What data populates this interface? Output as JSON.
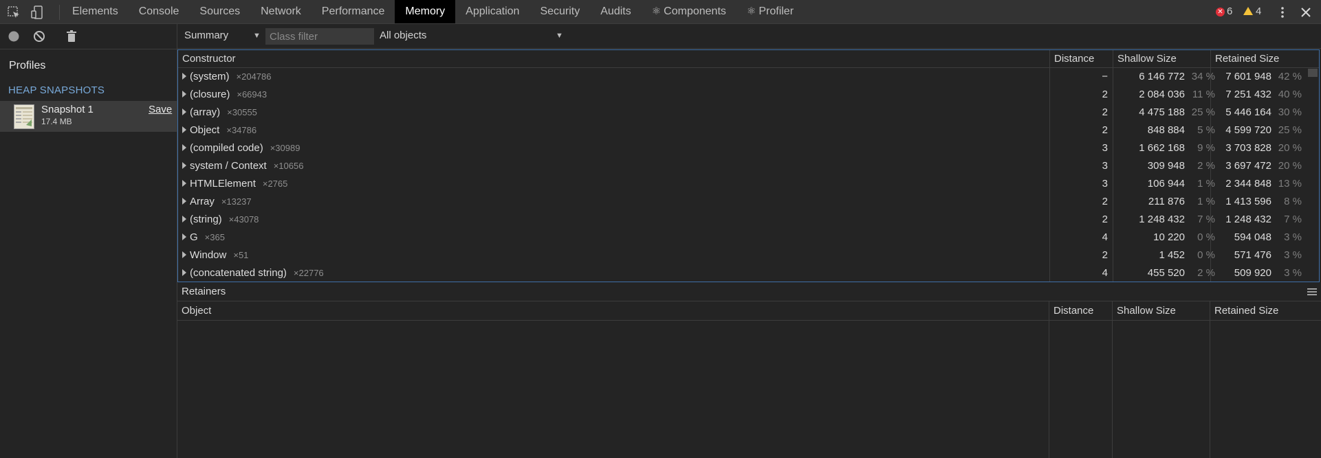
{
  "tabs": [
    {
      "label": "Elements"
    },
    {
      "label": "Console"
    },
    {
      "label": "Sources"
    },
    {
      "label": "Network"
    },
    {
      "label": "Performance"
    },
    {
      "label": "Memory",
      "active": true
    },
    {
      "label": "Application"
    },
    {
      "label": "Security"
    },
    {
      "label": "Audits"
    },
    {
      "label": "Components",
      "icon": "react-icon"
    },
    {
      "label": "Profiler",
      "icon": "react-icon"
    }
  ],
  "issues": {
    "errors": "6",
    "warnings": "4"
  },
  "sidebar": {
    "title": "Profiles",
    "section": "HEAP SNAPSHOTS",
    "snapshot": {
      "name": "Snapshot 1",
      "size": "17.4 MB",
      "save_label": "Save"
    }
  },
  "toolbar": {
    "view": "Summary",
    "class_filter_placeholder": "Class filter",
    "objects": "All objects"
  },
  "grid": {
    "columns": [
      "Constructor",
      "Distance",
      "Shallow Size",
      "Retained Size"
    ],
    "rows": [
      {
        "name": "(system)",
        "count": "×204786",
        "distance": "−",
        "shallow": "6 146 772",
        "shallow_pct": "34 %",
        "retained": "7 601 948",
        "retained_pct": "42 %"
      },
      {
        "name": "(closure)",
        "count": "×66943",
        "distance": "2",
        "shallow": "2 084 036",
        "shallow_pct": "11 %",
        "retained": "7 251 432",
        "retained_pct": "40 %"
      },
      {
        "name": "(array)",
        "count": "×30555",
        "distance": "2",
        "shallow": "4 475 188",
        "shallow_pct": "25 %",
        "retained": "5 446 164",
        "retained_pct": "30 %"
      },
      {
        "name": "Object",
        "count": "×34786",
        "distance": "2",
        "shallow": "848 884",
        "shallow_pct": "5 %",
        "retained": "4 599 720",
        "retained_pct": "25 %"
      },
      {
        "name": "(compiled code)",
        "count": "×30989",
        "distance": "3",
        "shallow": "1 662 168",
        "shallow_pct": "9 %",
        "retained": "3 703 828",
        "retained_pct": "20 %"
      },
      {
        "name": "system / Context",
        "count": "×10656",
        "distance": "3",
        "shallow": "309 948",
        "shallow_pct": "2 %",
        "retained": "3 697 472",
        "retained_pct": "20 %"
      },
      {
        "name": "HTMLElement",
        "count": "×2765",
        "distance": "3",
        "shallow": "106 944",
        "shallow_pct": "1 %",
        "retained": "2 344 848",
        "retained_pct": "13 %"
      },
      {
        "name": "Array",
        "count": "×13237",
        "distance": "2",
        "shallow": "211 876",
        "shallow_pct": "1 %",
        "retained": "1 413 596",
        "retained_pct": "8 %"
      },
      {
        "name": "(string)",
        "count": "×43078",
        "distance": "2",
        "shallow": "1 248 432",
        "shallow_pct": "7 %",
        "retained": "1 248 432",
        "retained_pct": "7 %"
      },
      {
        "name": "G",
        "count": "×365",
        "distance": "4",
        "shallow": "10 220",
        "shallow_pct": "0 %",
        "retained": "594 048",
        "retained_pct": "3 %"
      },
      {
        "name": "Window",
        "count": "×51",
        "distance": "2",
        "shallow": "1 452",
        "shallow_pct": "0 %",
        "retained": "571 476",
        "retained_pct": "3 %"
      },
      {
        "name": "(concatenated string)",
        "count": "×22776",
        "distance": "4",
        "shallow": "455 520",
        "shallow_pct": "2 %",
        "retained": "509 920",
        "retained_pct": "3 %"
      }
    ]
  },
  "retainers": {
    "title": "Retainers",
    "columns": [
      "Object",
      "Distance",
      "Shallow Size",
      "Retained Size"
    ]
  }
}
